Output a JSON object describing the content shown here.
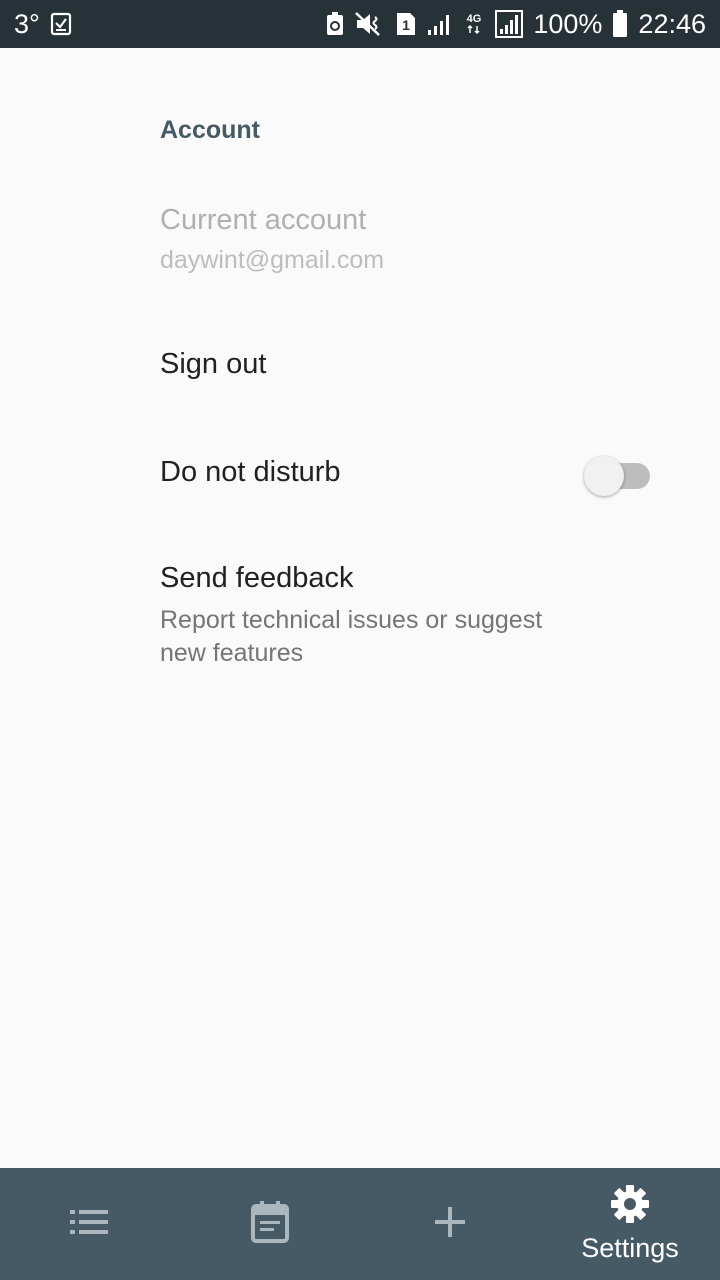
{
  "status_bar": {
    "temperature": "3°",
    "battery_percent": "100%",
    "time": "22:46",
    "icons": [
      "clipboard-check-icon",
      "battery-saver-icon",
      "mute-icon",
      "sim-1-icon",
      "signal-icon",
      "4g-icon",
      "signal-full-icon",
      "battery-icon"
    ]
  },
  "settings": {
    "section_account": "Account",
    "current_account_title": "Current account",
    "current_account_email": "daywint@gmail.com",
    "sign_out": "Sign out",
    "do_not_disturb": "Do not disturb",
    "do_not_disturb_enabled": false,
    "send_feedback_title": "Send feedback",
    "send_feedback_summary_line1": "Report technical issues or suggest",
    "send_feedback_summary_line2": "new features"
  },
  "bottom_nav": {
    "items": [
      {
        "icon": "list-icon",
        "label": ""
      },
      {
        "icon": "calendar-icon",
        "label": ""
      },
      {
        "icon": "add-icon",
        "label": ""
      },
      {
        "icon": "gear-icon",
        "label": "Settings",
        "active": true
      }
    ]
  },
  "colors": {
    "status_bar_bg": "#263238",
    "nav_bg": "#455a64",
    "section_header": "#455a64",
    "background": "#fafafa"
  }
}
